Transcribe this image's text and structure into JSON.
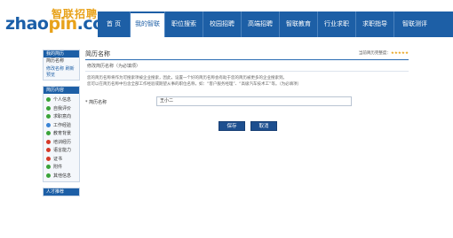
{
  "logo": {
    "cn": "智联招聘",
    "en_a": "zhao",
    "en_b": "pin",
    "en_c": ".com"
  },
  "nav": {
    "items": [
      {
        "label": "首 页",
        "active": false
      },
      {
        "label": "我的智联",
        "active": true
      },
      {
        "label": "职位搜索",
        "active": false
      },
      {
        "label": "校园招聘",
        "active": false
      },
      {
        "label": "高端招聘",
        "active": false
      },
      {
        "label": "智联教育",
        "active": false
      },
      {
        "label": "行业求职",
        "active": false
      },
      {
        "label": "求职指导",
        "active": false
      },
      {
        "label": "智联测评",
        "active": false
      }
    ]
  },
  "sidebar": {
    "section1_title": "我的简历",
    "section1_sub": "简历名称",
    "section1_links": [
      "修改名称",
      "刷新",
      "预览"
    ],
    "section2_title": "简历内容",
    "items": [
      {
        "label": "个人信息",
        "status": "green"
      },
      {
        "label": "自我评价",
        "status": "green"
      },
      {
        "label": "求职意向",
        "status": "green"
      },
      {
        "label": "工作经验",
        "status": "blue"
      },
      {
        "label": "教育背景",
        "status": "green"
      },
      {
        "label": "培训经历",
        "status": "red"
      },
      {
        "label": "语言能力",
        "status": "red"
      },
      {
        "label": "证书",
        "status": "red"
      },
      {
        "label": "附件",
        "status": "green"
      },
      {
        "label": "其他信息",
        "status": "green"
      }
    ],
    "section3_title": "人才推荐"
  },
  "main": {
    "title": "简历名称",
    "rating_label": "当前简历完整度：",
    "rating_stars": "★★★★★",
    "hint": "修改简历名称（为必填项）",
    "desc1": "您的简历名称将作为可搜索项被企业搜索，因此，设置一个好的简历名称会有助于您的简历被更多的企业搜索到。",
    "desc2": "您可以在简历名称中包含全部工作经验或期望从事的职位名称，如：“客户服务经理”、“高级汽车技术工”等。（为必填项）",
    "field_label": "* 简历名称",
    "field_value": "王小二",
    "save_label": "保存",
    "cancel_label": "取消"
  },
  "colors": {
    "brand_blue": "#1d5fa6",
    "brand_orange": "#e8a21a",
    "ok_green": "#3aa43a",
    "missing_red": "#d63a2a"
  }
}
